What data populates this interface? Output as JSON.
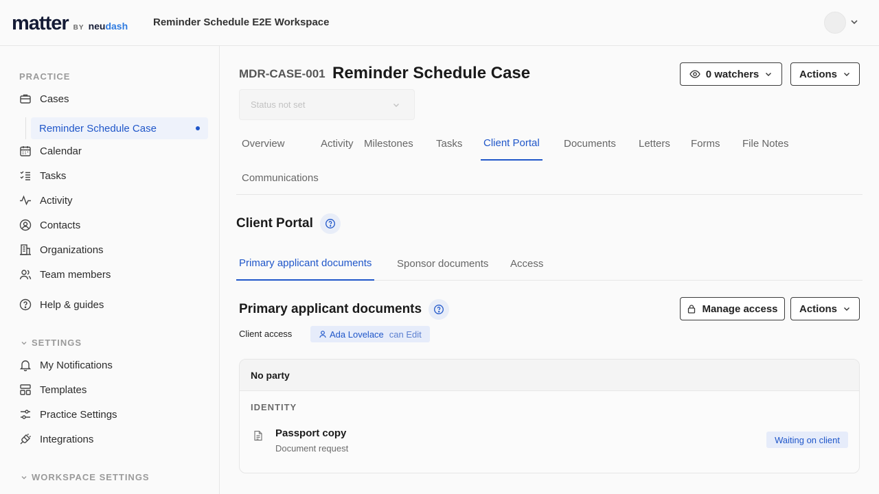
{
  "header": {
    "logo_main": "matter",
    "logo_by": "BY",
    "logo_brand_a": "neu",
    "logo_brand_b": "dash",
    "workspace_title": "Reminder Schedule E2E Workspace"
  },
  "sidebar": {
    "practice_label": "PRACTICE",
    "items": [
      {
        "label": "Cases",
        "icon": "briefcase-icon"
      },
      {
        "label": "Calendar",
        "icon": "calendar-icon"
      },
      {
        "label": "Tasks",
        "icon": "checklist-icon"
      },
      {
        "label": "Activity",
        "icon": "activity-icon"
      },
      {
        "label": "Contacts",
        "icon": "user-circle-icon"
      },
      {
        "label": "Organizations",
        "icon": "building-icon"
      },
      {
        "label": "Team members",
        "icon": "users-icon"
      },
      {
        "label": "Help & guides",
        "icon": "help-icon"
      }
    ],
    "active_case": "Reminder Schedule Case",
    "settings_label": "SETTINGS",
    "settings_items": [
      {
        "label": "My Notifications",
        "icon": "bell-icon"
      },
      {
        "label": "Templates",
        "icon": "templates-icon"
      },
      {
        "label": "Practice Settings",
        "icon": "sliders-icon"
      },
      {
        "label": "Integrations",
        "icon": "plug-icon"
      }
    ],
    "workspace_settings_label": "WORKSPACE SETTINGS"
  },
  "case": {
    "id": "MDR-CASE-001",
    "title": "Reminder Schedule Case",
    "watchers_label": "0 watchers",
    "actions_label": "Actions",
    "status_placeholder": "Status not set"
  },
  "tabs": [
    "Overview",
    "Activity",
    "Milestones",
    "Tasks",
    "Client Portal",
    "Documents",
    "Letters",
    "Forms",
    "File Notes",
    "Communications"
  ],
  "portal": {
    "title": "Client Portal",
    "subtabs": [
      "Primary applicant documents",
      "Sponsor documents",
      "Access"
    ],
    "panel_title": "Primary applicant documents",
    "manage_access_label": "Manage access",
    "actions_label": "Actions",
    "client_access_label": "Client access",
    "access_person": "Ada Lovelace",
    "access_permission": "can Edit",
    "party_label": "No party",
    "group_label": "IDENTITY",
    "doc_name": "Passport copy",
    "doc_type": "Document request",
    "doc_status": "Waiting on client"
  },
  "colors": {
    "accent": "#1f56c9",
    "accent_bg": "#e6ecfa"
  }
}
